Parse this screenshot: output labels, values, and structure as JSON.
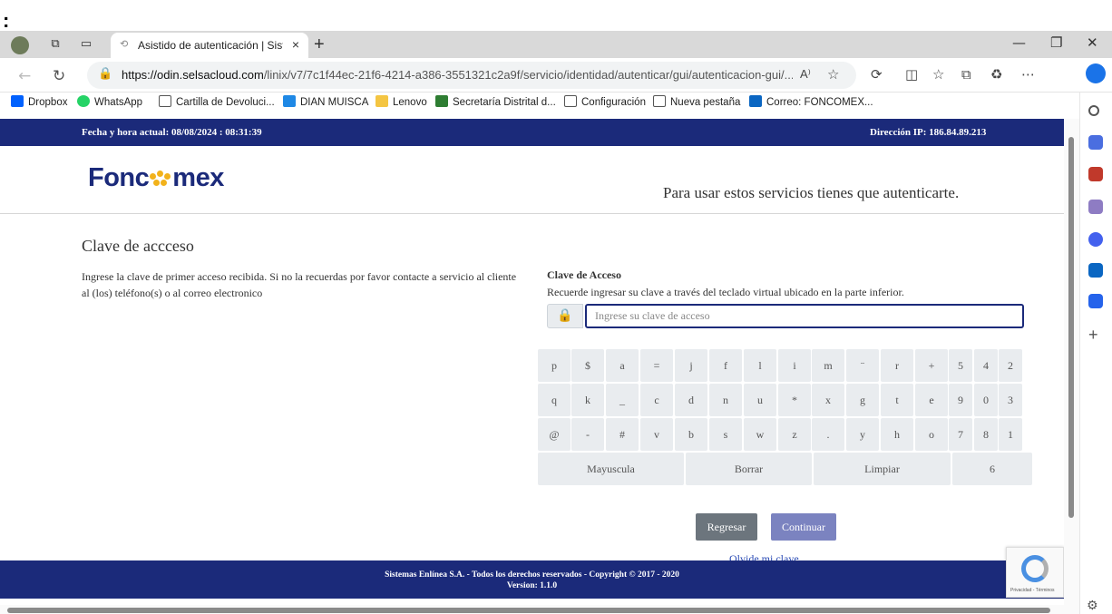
{
  "stray_char": ":",
  "browser": {
    "tab_title": "Asistido de autenticación | Sistem",
    "tab_close": "×",
    "new_tab": "+",
    "url_host": "https://odin.selsacloud.com",
    "url_path": "/linix/v7/7c1f44ec-21f6-4214-a386-3551321c2a9f/servicio/identidad/autenticar/gui/autenticacion-gui/...",
    "read_aloud": "A⁾",
    "bookmarks": [
      {
        "label": "Dropbox",
        "color": "#0061fe"
      },
      {
        "label": "WhatsApp",
        "color": "#25d366"
      },
      {
        "label": "Cartilla de Devoluci...",
        "color": "#ffffff"
      },
      {
        "label": "DIAN MUISCA",
        "color": "#1e88e5"
      },
      {
        "label": "Lenovo",
        "color": "#f4c542"
      },
      {
        "label": "Secretaría Distrital d...",
        "color": "#2e7d32"
      },
      {
        "label": "Configuración",
        "color": "#ffffff"
      },
      {
        "label": "Nueva pestaña",
        "color": "#ffffff"
      },
      {
        "label": "Correo: FONCOMEX...",
        "color": "#0a66c2"
      }
    ]
  },
  "page": {
    "datetime": "Fecha y hora actual: 08/08/2024 : 08:31:39",
    "ip": "Dirección IP: 186.84.89.213",
    "logo_left": "Fonc",
    "logo_right": "mex",
    "tagline": "Para usar estos servicios tienes que autenticarte.",
    "heading": "Clave de accceso",
    "intro": "Ingrese la clave de primer acceso recibida. Si no la recuerdas por favor contacte a servicio al cliente al (los) teléfono(s) o al correo electronico",
    "field_label": "Clave de Acceso",
    "field_hint": "Recuerde ingresar su clave a través del teclado virtual ubicado en la parte inferior.",
    "field_placeholder": "Ingrese su clave de acceso",
    "lock_glyph": "🔒",
    "keyboard": {
      "rows": [
        [
          "p",
          "$",
          "a",
          "=",
          "j",
          "f",
          "l",
          "i",
          "m",
          "¨",
          "r",
          "+",
          "5",
          "4",
          "2"
        ],
        [
          "q",
          "k",
          "_",
          "c",
          "d",
          "n",
          "u",
          "*",
          "x",
          "g",
          "t",
          "e",
          "9",
          "0",
          "3"
        ],
        [
          "@",
          "-",
          "#",
          "v",
          "b",
          "s",
          "w",
          "z",
          ".",
          "y",
          "h",
          "o",
          "7",
          "8",
          "1"
        ]
      ],
      "mayuscula": "Mayuscula",
      "borrar": "Borrar",
      "limpiar": "Limpiar",
      "six": "6"
    },
    "btn_back": "Regresar",
    "btn_continue": "Continuar",
    "forgot": "Olvide mi clave",
    "footer_line1": "Sistemas Enlínea S.A. - Todos los derechos reservados - Copyright © 2017 - 2020",
    "footer_line2": "Version: 1.1.0",
    "recaptcha_text": "Privacidad - Términos"
  }
}
